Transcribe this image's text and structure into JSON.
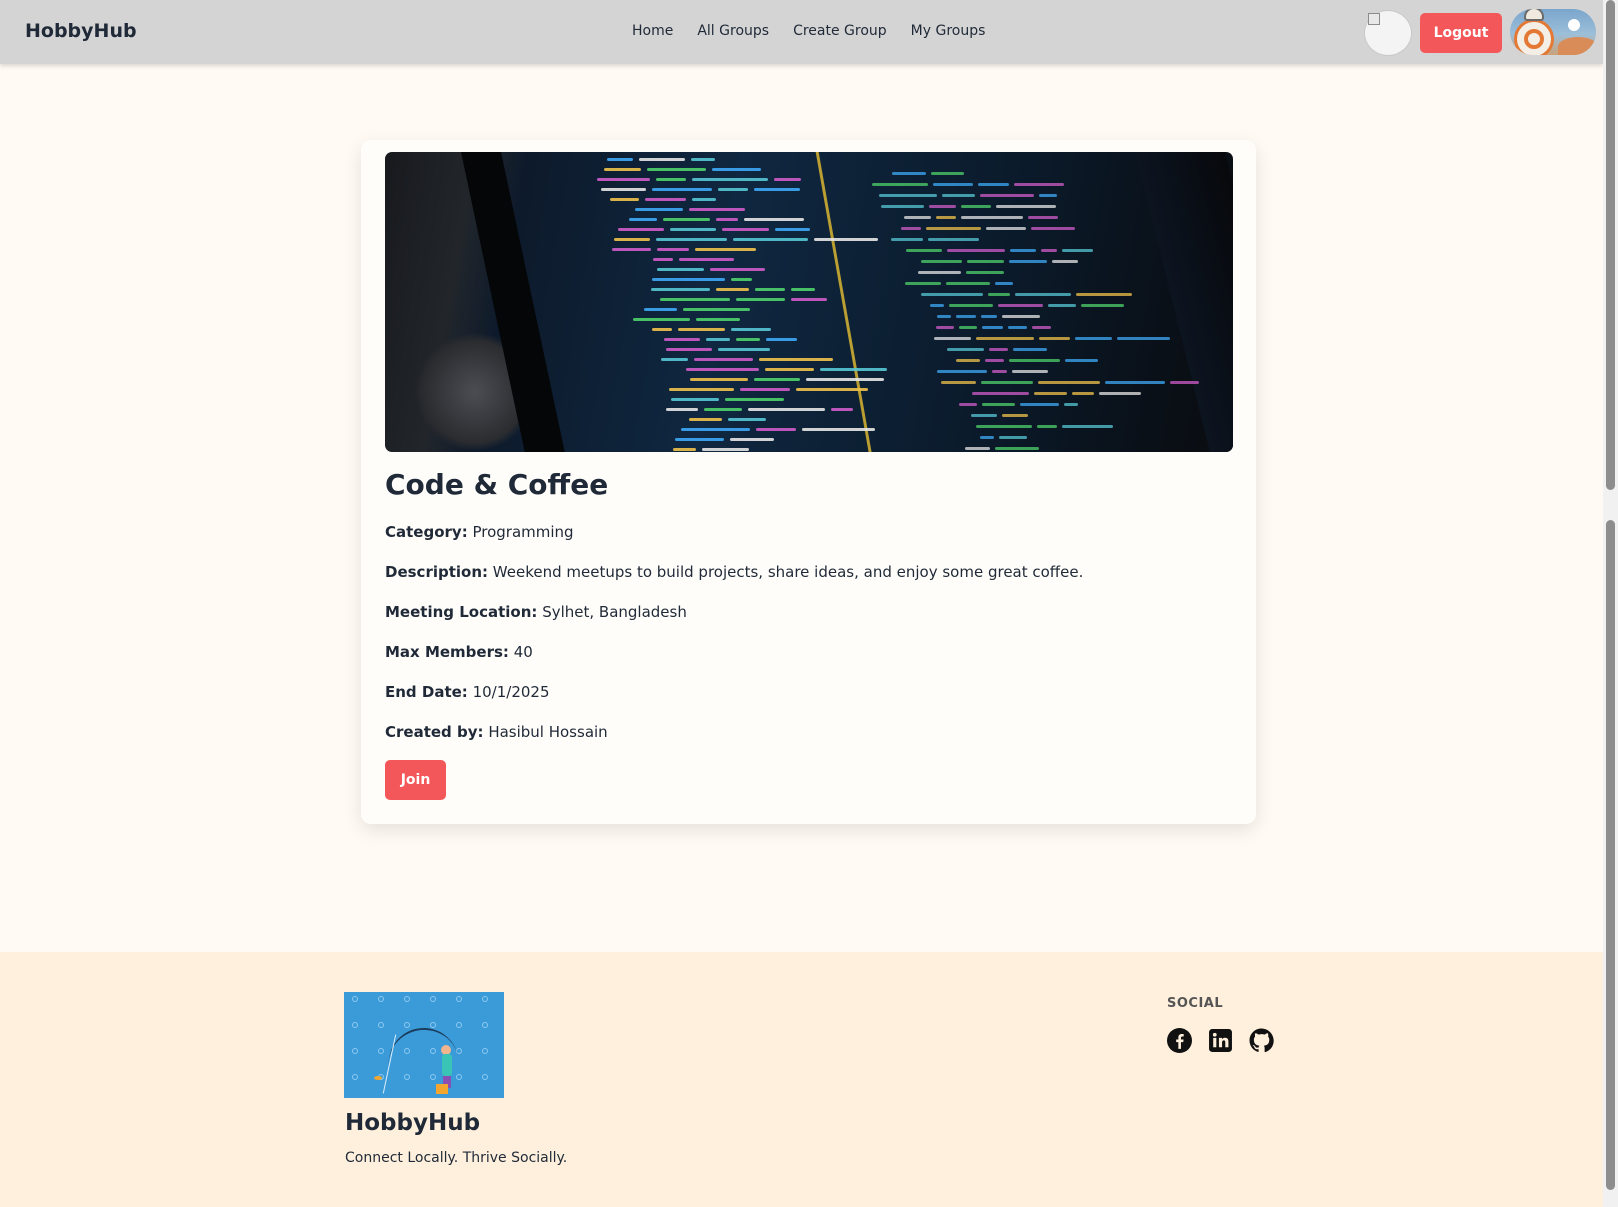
{
  "navbar": {
    "brand": "HobbyHub",
    "links": [
      "Home",
      "All Groups",
      "Create Group",
      "My Groups"
    ],
    "logout_label": "Logout"
  },
  "group": {
    "title": "Code & Coffee",
    "category_label": "Category:",
    "category": "Programming",
    "description_label": "Description:",
    "description": "Weekend meetups to build projects, share ideas, and enjoy some great coffee.",
    "location_label": "Meeting Location:",
    "location": "Sylhet, Bangladesh",
    "max_members_label": "Max Members:",
    "max_members": "40",
    "end_date_label": "End Date:",
    "end_date": "10/1/2025",
    "created_by_label": "Created by:",
    "created_by": "Hasibul Hossain",
    "join_label": "Join"
  },
  "footer": {
    "brand": "HobbyHub",
    "tagline": "Connect Locally. Thrive Socially.",
    "social_title": "SOCIAL",
    "social_icons": [
      "facebook-icon",
      "linkedin-icon",
      "github-icon"
    ]
  },
  "colors": {
    "accent_red": "#f4575a",
    "navbar_bg": "#d4d4d4",
    "page_bg": "#fffaf3",
    "footer_bg": "#fef0dc"
  }
}
